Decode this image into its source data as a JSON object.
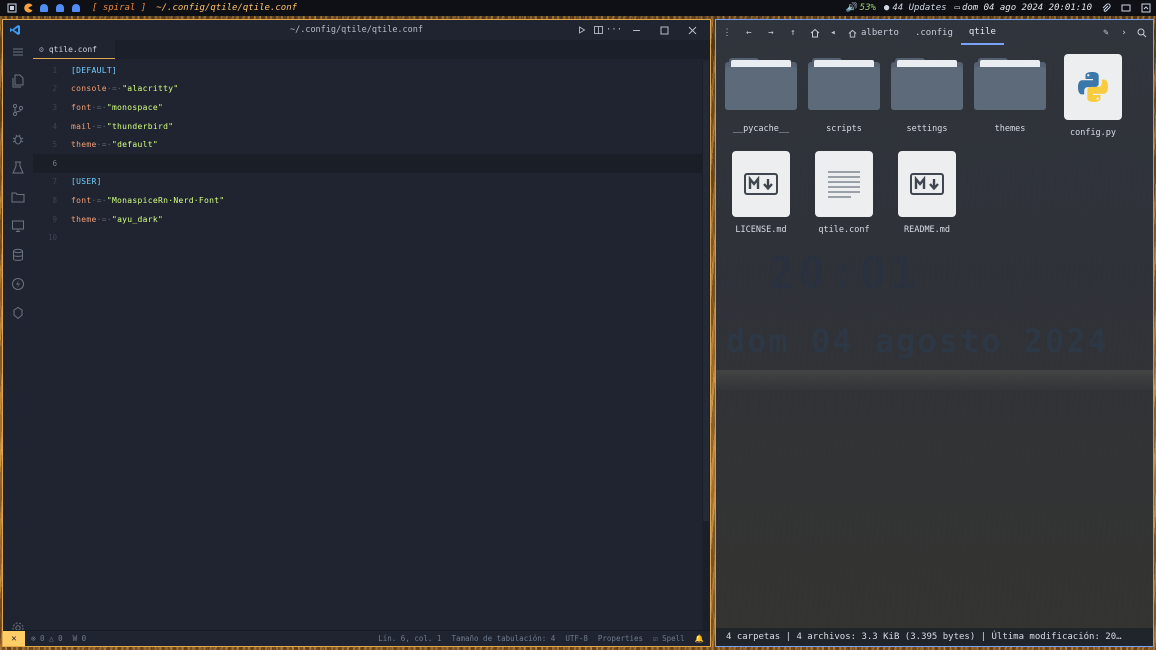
{
  "topbar": {
    "layout": "[ spiral ]",
    "window_title": "~/.config/qtile/qtile.conf",
    "battery": "53%",
    "updates": "44 Updates",
    "datetime": "dom 04 ago 2024 20:01:10"
  },
  "editor": {
    "title": "~/.config/qtile/qtile.conf",
    "tab_label": "qtile.conf",
    "lines": [
      {
        "n": "1",
        "parts": [
          [
            "sec",
            "[DEFAULT]"
          ]
        ]
      },
      {
        "n": "2",
        "parts": [
          [
            "key",
            "console"
          ],
          [
            "op",
            "·=·"
          ],
          [
            "str",
            "\"alacritty\""
          ]
        ]
      },
      {
        "n": "3",
        "parts": [
          [
            "key",
            "font"
          ],
          [
            "op",
            "·=·"
          ],
          [
            "str",
            "\"monospace\""
          ]
        ]
      },
      {
        "n": "4",
        "parts": [
          [
            "key",
            "mail"
          ],
          [
            "op",
            "·=·"
          ],
          [
            "str",
            "\"thunderbird\""
          ]
        ]
      },
      {
        "n": "5",
        "parts": [
          [
            "key",
            "theme"
          ],
          [
            "op",
            "·=·"
          ],
          [
            "str",
            "\"default\""
          ]
        ]
      },
      {
        "n": "6",
        "parts": []
      },
      {
        "n": "7",
        "parts": [
          [
            "sec",
            "[USER]"
          ]
        ]
      },
      {
        "n": "8",
        "parts": [
          [
            "key",
            "font"
          ],
          [
            "op",
            "·=·"
          ],
          [
            "str",
            "\"MonaspiceRn·Nerd·Font\""
          ]
        ]
      },
      {
        "n": "9",
        "parts": [
          [
            "key",
            "theme"
          ],
          [
            "op",
            "·=·"
          ],
          [
            "str",
            "\"ayu_dark\""
          ]
        ]
      },
      {
        "n": "10",
        "parts": []
      }
    ],
    "current_line": 6,
    "status": {
      "errors": "0",
      "warnings": "0",
      "w": "0",
      "position": "Lín. 6, col. 1",
      "tab_size": "Tamaño de tabulación: 4",
      "encoding": "UTF-8",
      "language": "Properties",
      "spell": "Spell",
      "settings_badge": "1"
    }
  },
  "files": {
    "breadcrumbs": [
      "alberto",
      ".config",
      "qtile"
    ],
    "items": [
      {
        "name": "__pycache__",
        "kind": "folder"
      },
      {
        "name": "scripts",
        "kind": "folder"
      },
      {
        "name": "settings",
        "kind": "folder"
      },
      {
        "name": "themes",
        "kind": "folder"
      },
      {
        "name": "config.py",
        "kind": "python"
      },
      {
        "name": "LICENSE.md",
        "kind": "markdown"
      },
      {
        "name": "qtile.conf",
        "kind": "text"
      },
      {
        "name": "README.md",
        "kind": "markdown"
      }
    ],
    "status": "4 carpetas  |  4 archivos: 3.3 KiB (3.395 bytes)  |  Última modificación: 20…",
    "wallpaper_clock": "20:01",
    "wallpaper_date": "dom 04 agosto 2024"
  },
  "colors": {
    "accent_orange": "#e0a84a",
    "accent_blue": "#7aa2f7"
  }
}
